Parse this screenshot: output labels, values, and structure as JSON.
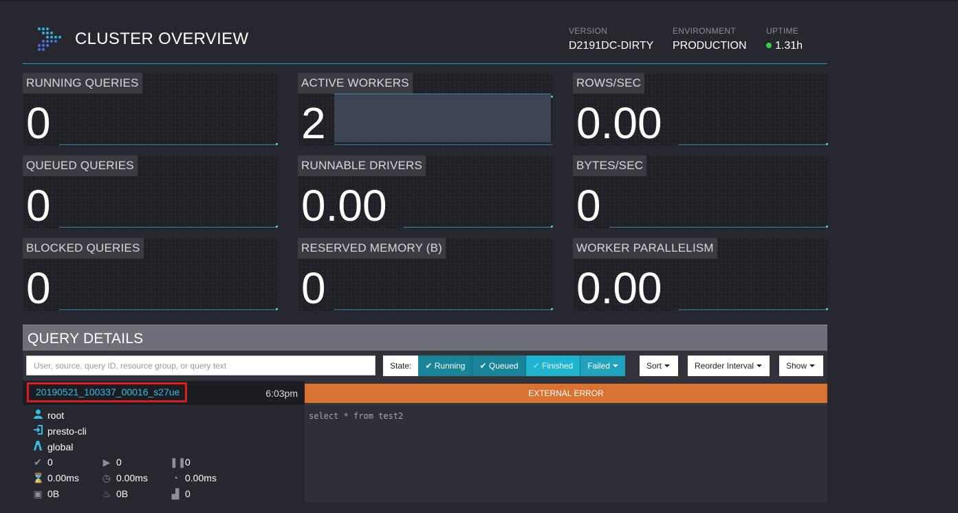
{
  "header": {
    "title": "CLUSTER OVERVIEW",
    "version_label": "VERSION",
    "version": "D2191DC-DIRTY",
    "environment_label": "ENVIRONMENT",
    "environment": "PRODUCTION",
    "uptime_label": "UPTIME",
    "uptime": "1.31h",
    "uptime_status_color": "#33d04a"
  },
  "tiles": {
    "running_queries": {
      "label": "RUNNING QUERIES",
      "value": "0"
    },
    "active_workers": {
      "label": "ACTIVE WORKERS",
      "value": "2"
    },
    "rows_sec": {
      "label": "ROWS/SEC",
      "value": "0.00"
    },
    "queued_queries": {
      "label": "QUEUED QUERIES",
      "value": "0"
    },
    "runnable_drivers": {
      "label": "RUNNABLE DRIVERS",
      "value": "0.00"
    },
    "bytes_sec": {
      "label": "BYTES/SEC",
      "value": "0"
    },
    "blocked_queries": {
      "label": "BLOCKED QUERIES",
      "value": "0"
    },
    "reserved_memory": {
      "label": "RESERVED MEMORY (B)",
      "value": "0"
    },
    "worker_parallelism": {
      "label": "WORKER PARALLELISM",
      "value": "0.00"
    }
  },
  "query_details": {
    "title": "QUERY DETAILS",
    "search_placeholder": "User, source, query ID, resource group, or query text",
    "state_label": "State:",
    "filters": [
      "Running",
      "Queued",
      "Finished",
      "Failed"
    ],
    "sort_label": "Sort",
    "reorder_label": "Reorder Interval",
    "show_label": "Show"
  },
  "query": {
    "id": "20190521_100337_00016_s27ue",
    "time": "6:03pm",
    "state": "EXTERNAL ERROR",
    "state_color": "#d97231",
    "sql": "select * from test2",
    "user": "root",
    "source": "presto-cli",
    "resource_group": "global",
    "completed_splits": "0",
    "running_splits": "0",
    "queued_splits": "0",
    "wall_time": "0.00ms",
    "elapsed_time": "0.00ms",
    "cpu_time": "0.00ms",
    "current_memory": "0B",
    "peak_memory": "0B",
    "cumulative_memory": "0"
  }
}
